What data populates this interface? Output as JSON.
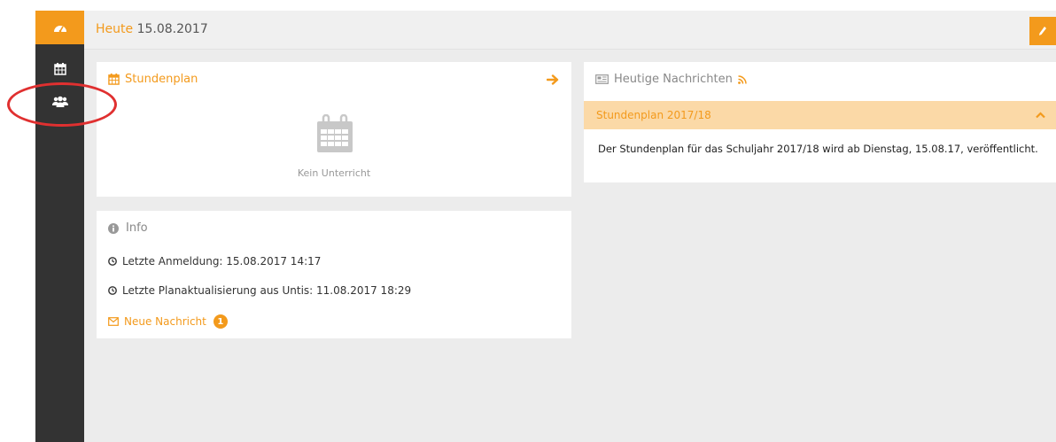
{
  "colors": {
    "accent": "#f39a1c",
    "sidebar": "#333333",
    "annotation": "#e03030"
  },
  "header": {
    "today_label": "Heute",
    "date": "15.08.2017"
  },
  "sidebar": {
    "items": [
      {
        "icon": "dashboard-icon",
        "active": true
      },
      {
        "icon": "calendar-icon",
        "active": false
      },
      {
        "icon": "users-icon",
        "active": false
      }
    ]
  },
  "timetable": {
    "title": "Stundenplan",
    "empty_text": "Kein Unterricht"
  },
  "info": {
    "title": "Info",
    "last_login": "Letzte Anmeldung: 15.08.2017 14:17",
    "last_update": "Letzte Planaktualisierung aus Untis: 11.08.2017 18:29",
    "new_message": "Neue Nachricht",
    "new_message_count": "1"
  },
  "news": {
    "title": "Heutige Nachrichten",
    "item_title": "Stundenplan 2017/18",
    "item_text": "Der Stundenplan für das Schuljahr 2017/18 wird ab Dienstag, 15.08.17, veröffentlicht."
  }
}
